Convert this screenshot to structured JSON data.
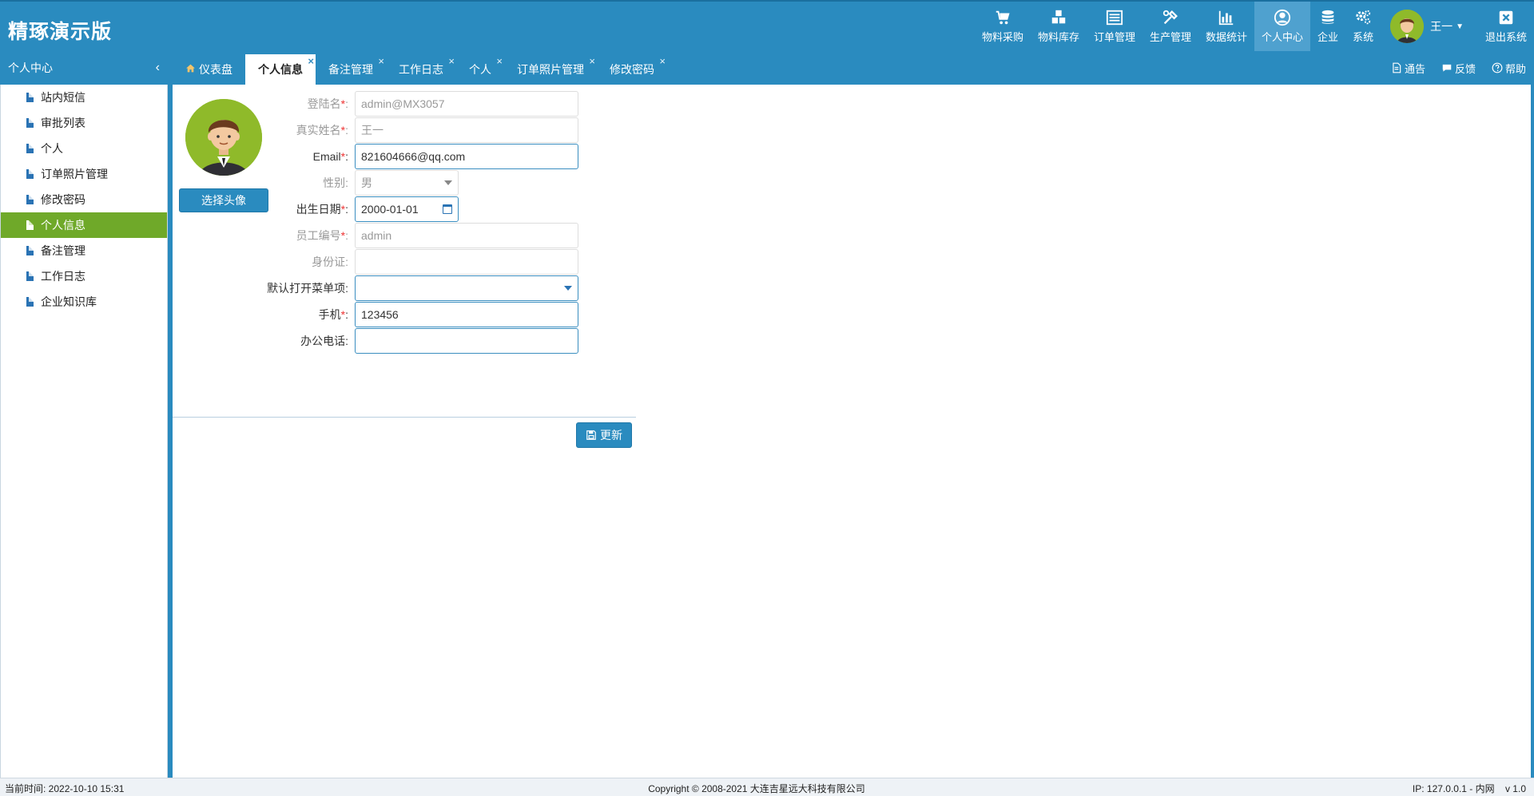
{
  "header": {
    "brand": "精琢演示版",
    "nav": [
      {
        "label": "物料采购",
        "icon": "cart-icon"
      },
      {
        "label": "物料库存",
        "icon": "cubes-icon"
      },
      {
        "label": "订单管理",
        "icon": "list-icon"
      },
      {
        "label": "生产管理",
        "icon": "tools-icon"
      },
      {
        "label": "数据统计",
        "icon": "bar-chart-icon"
      },
      {
        "label": "个人中心",
        "icon": "user-circle-icon",
        "active": true
      },
      {
        "label": "企业",
        "icon": "database-icon"
      },
      {
        "label": "系统",
        "icon": "gears-icon"
      }
    ],
    "user_name": "王一",
    "logout_label": "退出系统"
  },
  "tabstrip": {
    "side_title": "个人中心",
    "tabs": [
      {
        "label": "仪表盘"
      },
      {
        "label": "个人信息"
      },
      {
        "label": "备注管理"
      },
      {
        "label": "工作日志"
      },
      {
        "label": "个人"
      },
      {
        "label": "订单照片管理"
      },
      {
        "label": "修改密码"
      }
    ],
    "links": {
      "notice": "通告",
      "feedback": "反馈",
      "help": "帮助"
    }
  },
  "sidebar": {
    "items": [
      {
        "label": "站内短信"
      },
      {
        "label": "审批列表"
      },
      {
        "label": "个人"
      },
      {
        "label": "订单照片管理"
      },
      {
        "label": "修改密码"
      },
      {
        "label": "个人信息"
      },
      {
        "label": "备注管理"
      },
      {
        "label": "工作日志"
      },
      {
        "label": "企业知识库"
      }
    ]
  },
  "form": {
    "choose_avatar": "选择头像",
    "login_name": {
      "label": "登陆名",
      "value": "admin@MX3057"
    },
    "real_name": {
      "label": "真实姓名",
      "value": "王一"
    },
    "email": {
      "label": "Email",
      "value": "821604666@qq.com"
    },
    "gender": {
      "label": "性别:",
      "value": "男"
    },
    "birthday": {
      "label": "出生日期",
      "value": "2000-01-01"
    },
    "emp_no": {
      "label": "员工编号",
      "value": "admin"
    },
    "id_card": {
      "label": "身份证:",
      "value": ""
    },
    "default_menu": {
      "label": "默认打开菜单项:",
      "value": ""
    },
    "mobile": {
      "label": "手机",
      "value": "123456"
    },
    "office_phone": {
      "label": "办公电话:",
      "value": ""
    },
    "req_mark": "*",
    "colon": ":",
    "update": "更新"
  },
  "footer": {
    "time": "当前时间: 2022-10-10 15:31",
    "copyright": "Copyright © 2008-2021 大连吉星远大科技有限公司",
    "ip": "IP: 127.0.0.1 - 内网    v 1.0"
  }
}
